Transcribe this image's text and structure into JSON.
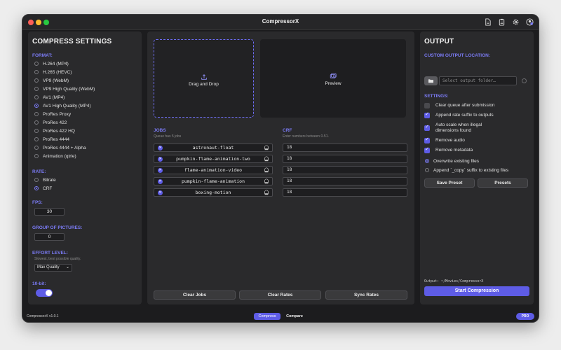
{
  "app": {
    "title": "CompressorX",
    "version": "CompressorX v1.0.1"
  },
  "toolbar_icons": [
    "document-icon",
    "clipboard-icon",
    "gear-icon",
    "account-icon"
  ],
  "left": {
    "heading": "COMPRESS SETTINGS",
    "format_label": "FORMAT:",
    "formats": [
      {
        "label": "H.264 (MP4)",
        "selected": false
      },
      {
        "label": "H.265 (HEVC)",
        "selected": false
      },
      {
        "label": "VP9 (WebM)",
        "selected": false
      },
      {
        "label": "VP9 High Quality (WebM)",
        "selected": false
      },
      {
        "label": "AV1 (MP4)",
        "selected": false
      },
      {
        "label": "AV1 High Quality (MP4)",
        "selected": true
      },
      {
        "label": "ProRes Proxy",
        "selected": false
      },
      {
        "label": "ProRes 422",
        "selected": false
      },
      {
        "label": "ProRes 422 HQ",
        "selected": false
      },
      {
        "label": "ProRes 4444",
        "selected": false
      },
      {
        "label": "ProRes 4444 + Alpha",
        "selected": false
      },
      {
        "label": "Animation (qtrle)",
        "selected": false
      }
    ],
    "rate_label": "RATE:",
    "rates": [
      {
        "label": "Bitrate",
        "selected": false
      },
      {
        "label": "CRF",
        "selected": true
      }
    ],
    "fps_label": "FPS:",
    "fps_value": "30",
    "gop_label": "GROUP OF PICTURES:",
    "gop_value": "0",
    "effort_label": "EFFORT LEVEL:",
    "effort_hint": "Slowest, best possible quality.",
    "effort_value": "Max Quality",
    "tenbit_label": "10-bit:",
    "tenbit_on": true
  },
  "center": {
    "drop_label": "Drag and Drop",
    "preview_label": "Preview",
    "jobs_label": "JOBS",
    "jobs_hint": "Queue has 5 jobs",
    "crf_label": "CRF",
    "crf_hint": "Enter numbers between 0-51.",
    "jobs": [
      {
        "name": "astronaut-float",
        "crf": "18"
      },
      {
        "name": "pumpkin-flame-animation-two",
        "crf": "18"
      },
      {
        "name": "flame-animation-video",
        "crf": "18"
      },
      {
        "name": "pumpkin-flame-animation",
        "crf": "18"
      },
      {
        "name": "boxing-motion",
        "crf": "18"
      }
    ],
    "clear_jobs": "Clear Jobs",
    "clear_rates": "Clear Rates",
    "sync_rates": "Sync Rates"
  },
  "right": {
    "heading": "OUTPUT",
    "custom_label": "CUSTOM OUTPUT LOCATION:",
    "folder_placeholder": "Select output folder…",
    "settings_label": "SETTINGS:",
    "checks": [
      {
        "label": "Clear queue after submission",
        "checked": false
      },
      {
        "label": "Append rate suffix to outputs",
        "checked": true
      },
      {
        "label": "Auto scale when illegal dimensions found",
        "checked": true
      },
      {
        "label": "Remove audio",
        "checked": true
      },
      {
        "label": "Remove metadata",
        "checked": true
      }
    ],
    "overwrite": [
      {
        "label": "Overwrite existing files",
        "selected": true
      },
      {
        "label": "Append `_copy` suffix to existing files",
        "selected": false
      }
    ],
    "save_preset": "Save Preset",
    "presets": "Presets",
    "output_path": "Output: ~/Movies/CompressorX",
    "start": "Start Compression"
  },
  "bottom": {
    "compress_tab": "Compress",
    "compare_tab": "Compare",
    "pro_badge": "PRO"
  },
  "colors": {
    "accent": "#5e5ce6",
    "accent_text": "#7b7bf5",
    "panel": "#2a2a2c",
    "window": "#1c1c1e"
  }
}
